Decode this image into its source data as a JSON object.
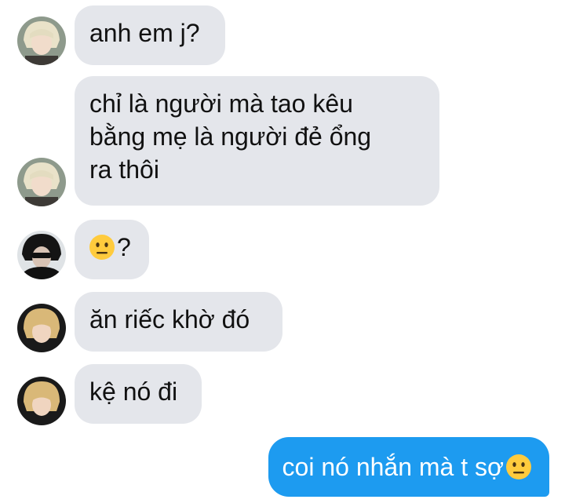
{
  "messages": [
    {
      "text": "anh em j?"
    },
    {
      "lines": [
        "chỉ là người mà tao kêu",
        "bằng mẹ là người đẻ ổng",
        "ra thôi"
      ]
    },
    {
      "text": "?",
      "leading_emoji": "neutral-face-emoji"
    },
    {
      "text": "ăn riếc khờ đó"
    },
    {
      "text": "kệ nó đi"
    }
  ],
  "outgoing": {
    "text": "coi nó nhắn mà t sợ",
    "trailing_emoji": "neutral-face-emoji"
  },
  "colors": {
    "incoming_bubble": "#e4e6eb",
    "outgoing_bubble": "#1d9bf0",
    "emoji": "#ffcb3d"
  }
}
